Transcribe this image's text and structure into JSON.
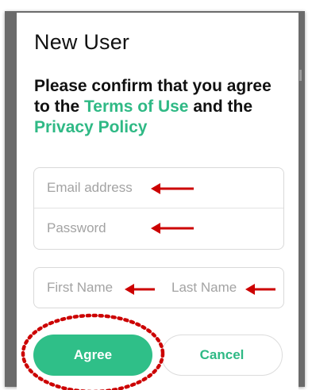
{
  "dialog": {
    "title": "New User",
    "confirm": {
      "prefix": "Please confirm that you agree to the ",
      "terms_link": "Terms of Use",
      "middle": " and the ",
      "privacy_link": "Privacy Policy"
    }
  },
  "form": {
    "email_placeholder": "Email address",
    "password_placeholder": "Password",
    "first_name_placeholder": "First Name",
    "last_name_placeholder": "Last Name"
  },
  "buttons": {
    "agree_label": "Agree",
    "cancel_label": "Cancel"
  },
  "annotations": {
    "arrow_color": "#cc0000",
    "highlight_color": "#cc0000"
  },
  "colors": {
    "accent": "#2fbf88",
    "link": "#2fb985",
    "backdrop": "#6b6b6b"
  }
}
